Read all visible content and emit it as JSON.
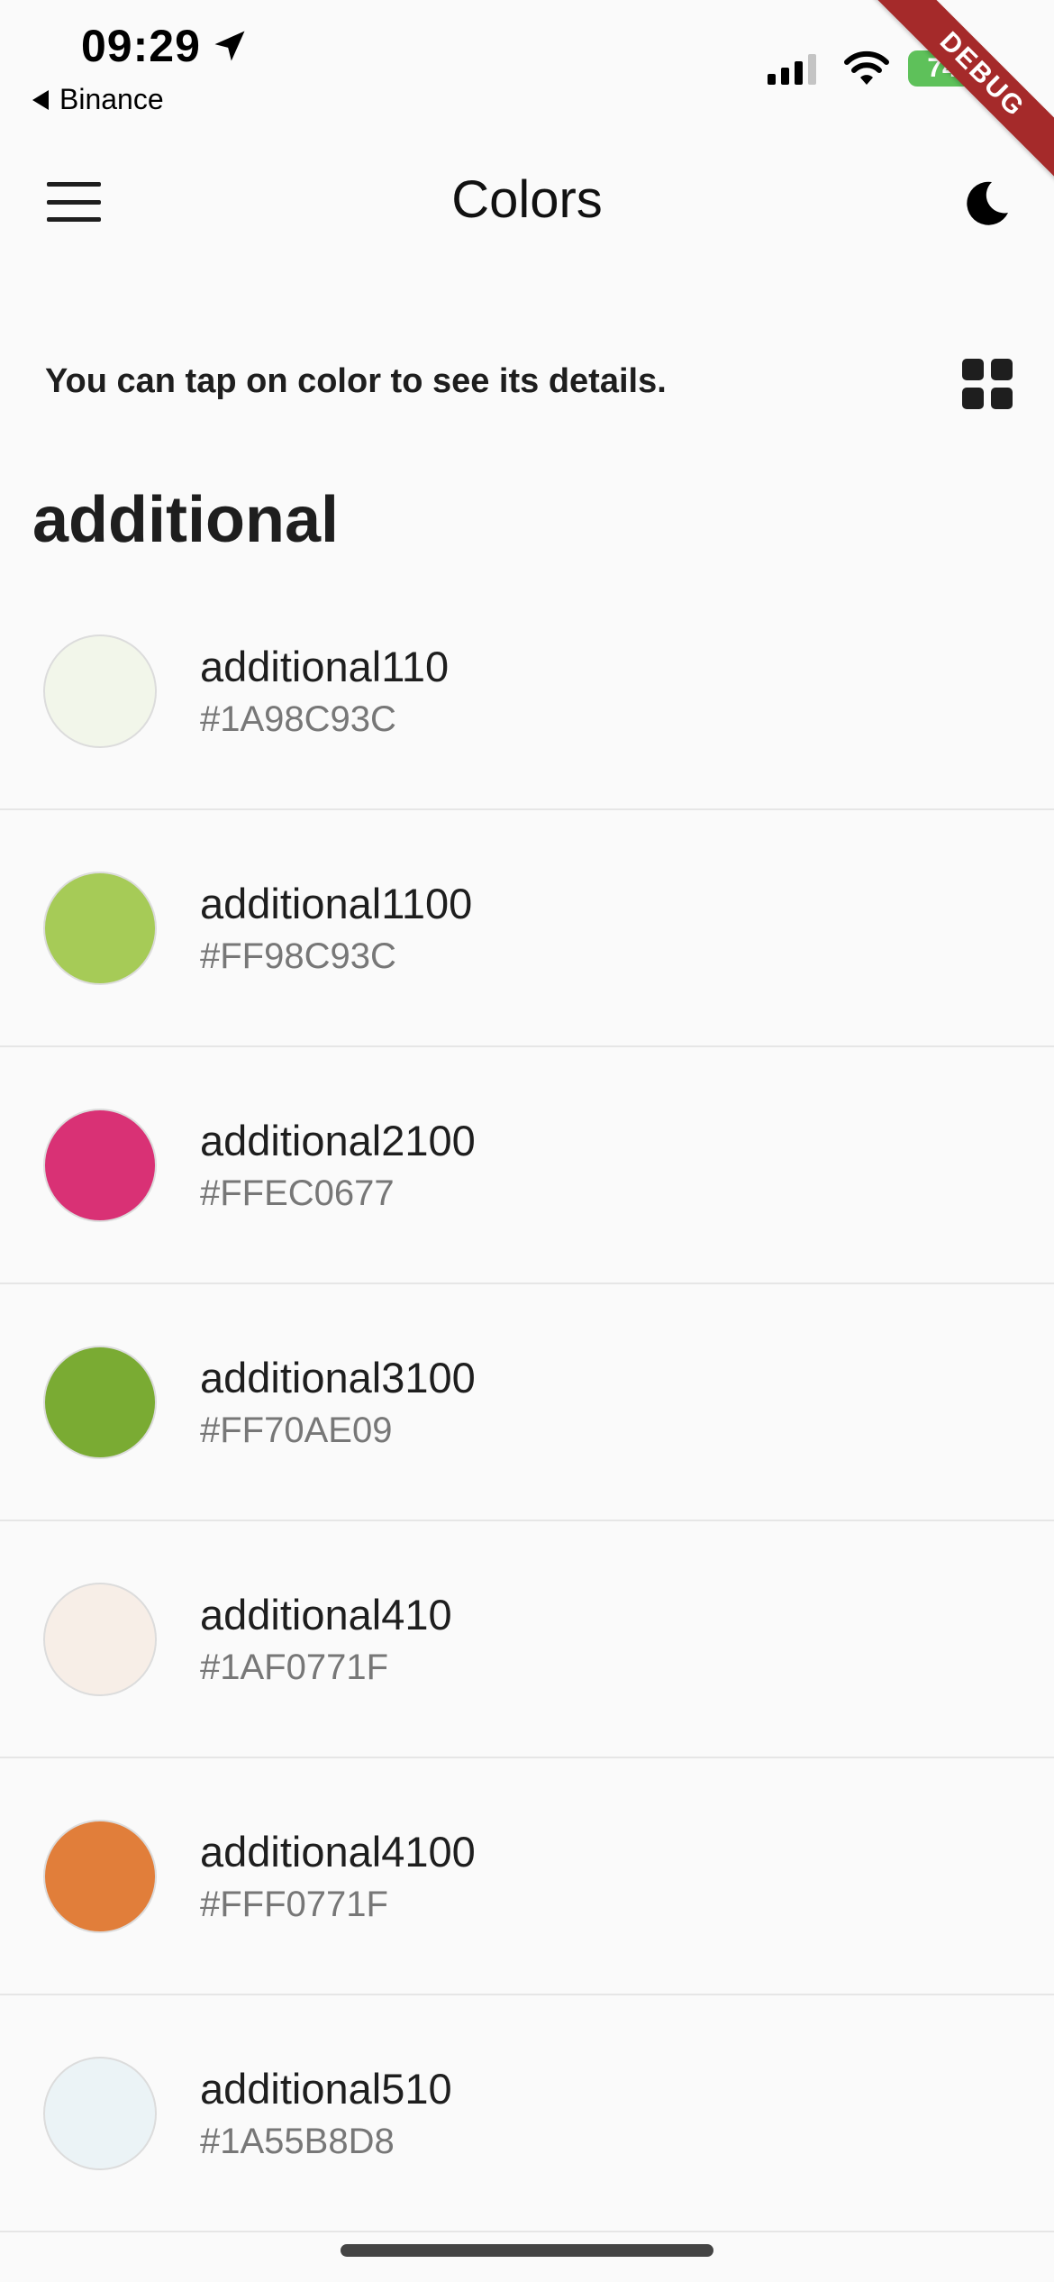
{
  "status_bar": {
    "time": "09:29",
    "back_app": "Binance",
    "battery": "74",
    "debug": "DEBUG"
  },
  "app_bar": {
    "title": "Colors",
    "menu_icon": "hamburger-menu-icon",
    "theme_icon": "moon-icon"
  },
  "hint": {
    "text": "You can tap on color to see its details.",
    "view_icon": "grid-view-icon"
  },
  "section": {
    "title": "additional"
  },
  "colors": [
    {
      "name": "additional110",
      "hex": "#1A98C93C",
      "swatch": "#f2f6ea"
    },
    {
      "name": "additional1100",
      "hex": "#FF98C93C",
      "swatch": "#a6cb57"
    },
    {
      "name": "additional2100",
      "hex": "#FFEC0677",
      "swatch": "#d93175"
    },
    {
      "name": "additional3100",
      "hex": "#FF70AE09",
      "swatch": "#7aab33"
    },
    {
      "name": "additional410",
      "hex": "#1AF0771F",
      "swatch": "#f7eee7"
    },
    {
      "name": "additional4100",
      "hex": "#FFF0771F",
      "swatch": "#e17e3a"
    },
    {
      "name": "additional510",
      "hex": "#1A55B8D8",
      "swatch": "#ebf3f6"
    }
  ]
}
